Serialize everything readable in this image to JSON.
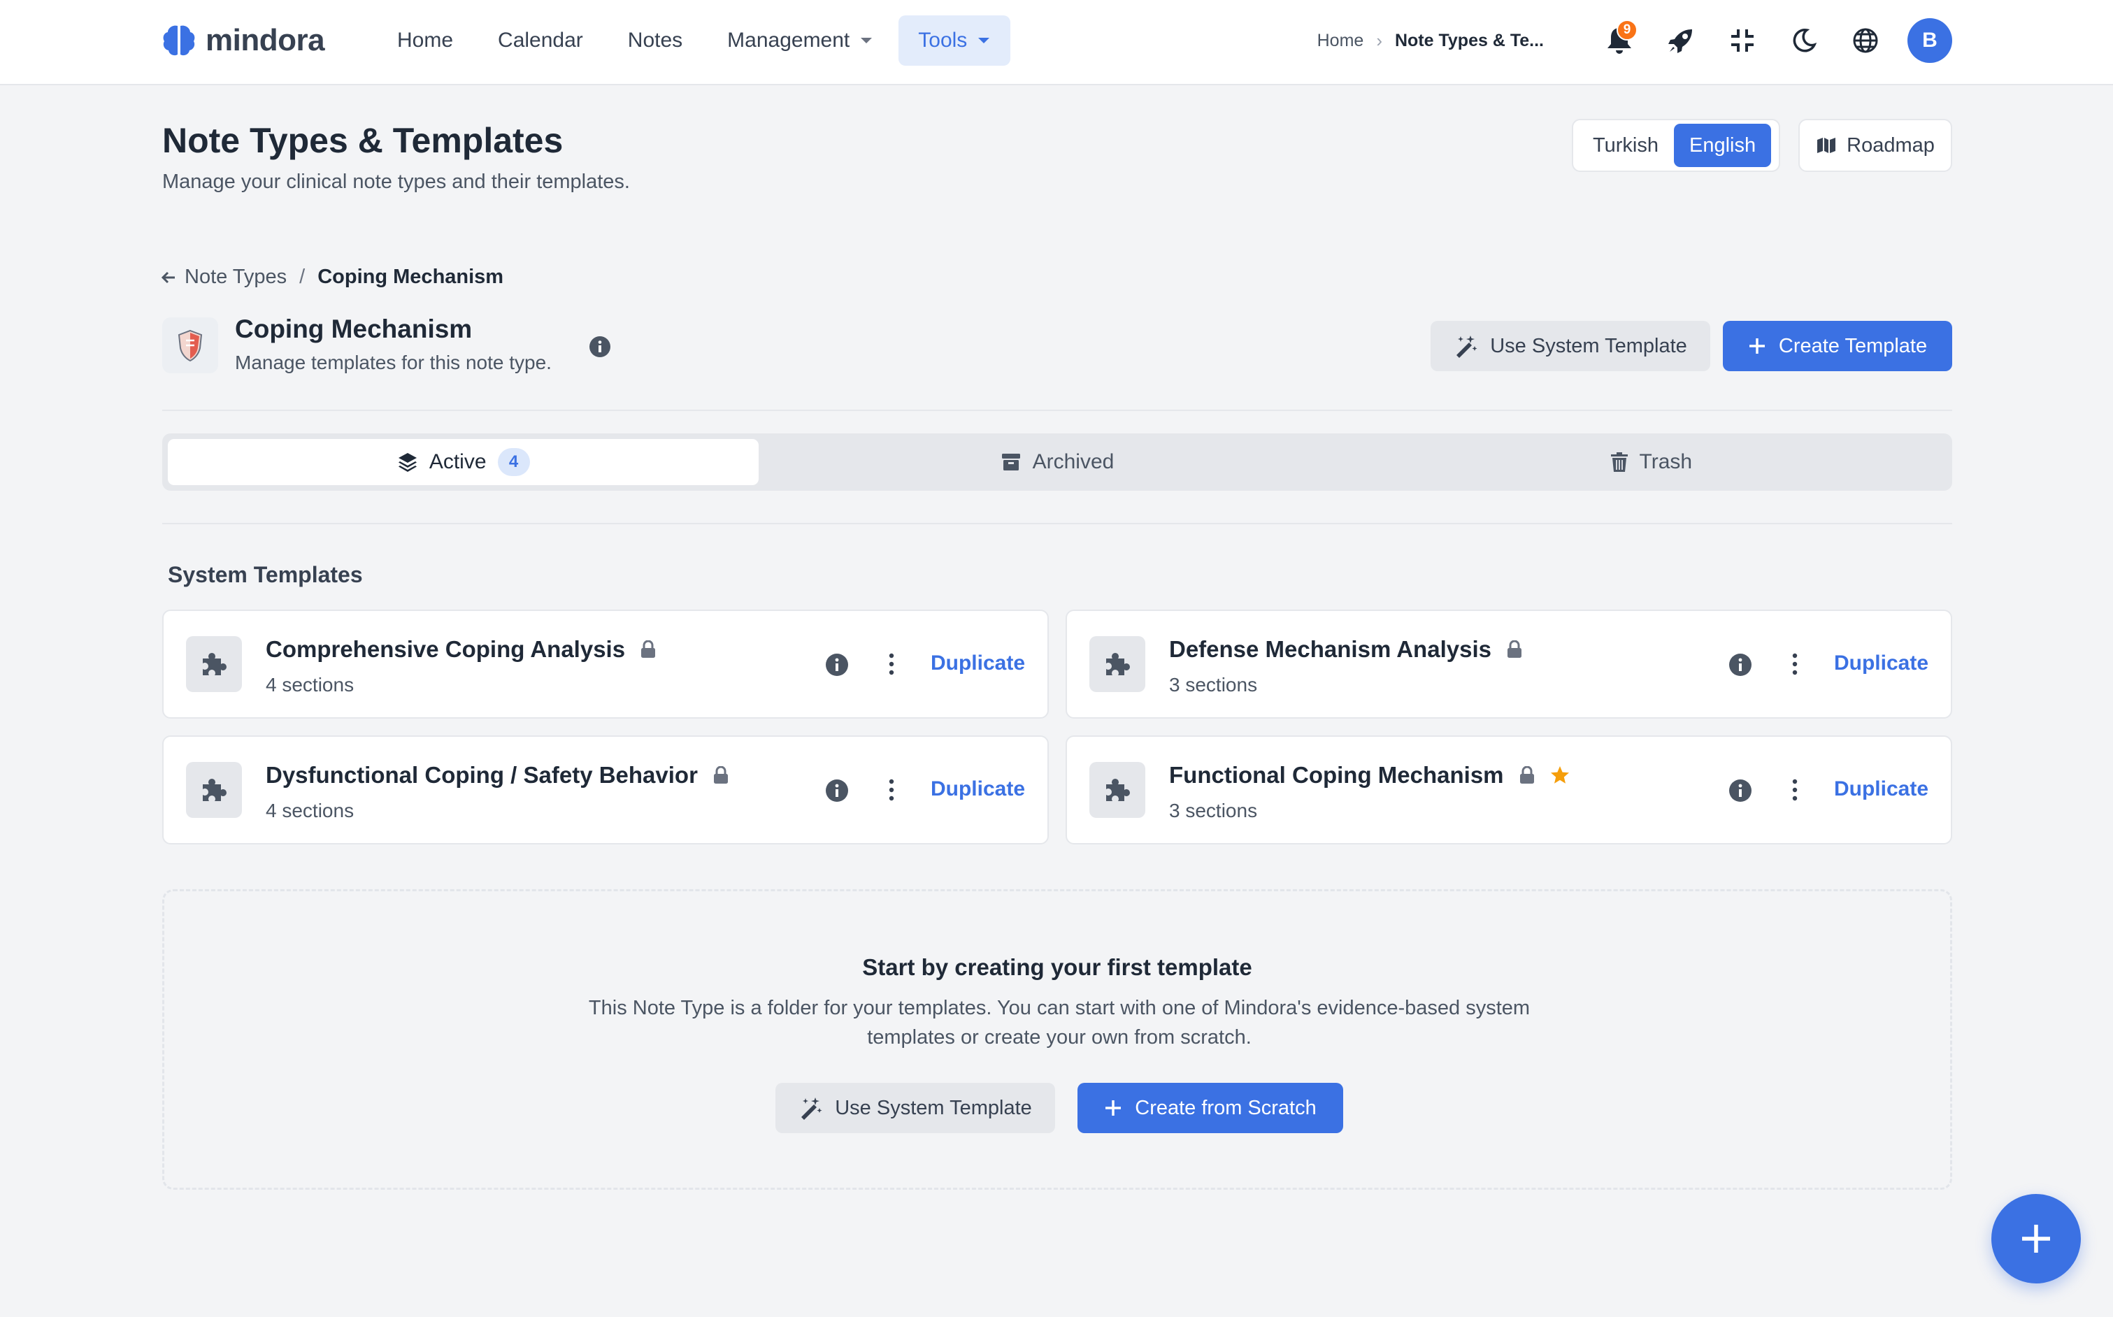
{
  "app": {
    "name": "mindora"
  },
  "nav": {
    "items": [
      {
        "label": "Home"
      },
      {
        "label": "Calendar"
      },
      {
        "label": "Notes"
      },
      {
        "label": "Management"
      },
      {
        "label": "Tools"
      }
    ],
    "breadcrumb": {
      "home": "Home",
      "current": "Note Types & Te..."
    },
    "notification_count": "9",
    "avatar_initial": "B"
  },
  "page": {
    "title": "Note Types & Templates",
    "subtitle": "Manage your clinical note types and their templates.",
    "languages": {
      "turkish": "Turkish",
      "english": "English",
      "selected": "English"
    },
    "roadmap_label": "Roadmap"
  },
  "sub_breadcrumb": {
    "parent": "Note Types",
    "separator": "/",
    "current": "Coping Mechanism"
  },
  "note_type": {
    "title": "Coping Mechanism",
    "subtitle": "Manage templates for this note type.",
    "use_system_template": "Use System Template",
    "create_template": "Create Template"
  },
  "tabs": [
    {
      "label": "Active",
      "count": "4",
      "selected": true
    },
    {
      "label": "Archived"
    },
    {
      "label": "Trash"
    }
  ],
  "system_templates": {
    "title": "System Templates",
    "items": [
      {
        "name": "Comprehensive Coping Analysis",
        "sections": "4 sections",
        "locked": true,
        "starred": false,
        "action": "Duplicate"
      },
      {
        "name": "Defense Mechanism Analysis",
        "sections": "3 sections",
        "locked": true,
        "starred": false,
        "action": "Duplicate"
      },
      {
        "name": "Dysfunctional Coping / Safety Behavior",
        "sections": "4 sections",
        "locked": true,
        "starred": false,
        "action": "Duplicate"
      },
      {
        "name": "Functional Coping Mechanism",
        "sections": "3 sections",
        "locked": true,
        "starred": true,
        "action": "Duplicate"
      }
    ]
  },
  "empty_state": {
    "title": "Start by creating your first template",
    "description": "This Note Type is a folder for your templates. You can start with one of Mindora's evidence-based system templates or create your own from scratch.",
    "use_system_template": "Use System Template",
    "create_from_scratch": "Create from Scratch"
  },
  "colors": {
    "primary": "#3b71e3",
    "background": "#f3f4f6",
    "star": "#f59e0b",
    "badge": "#f97316"
  }
}
